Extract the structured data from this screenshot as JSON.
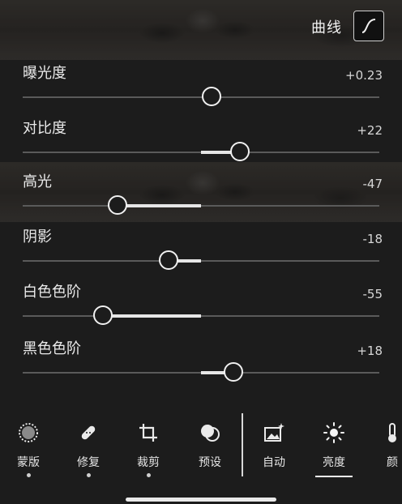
{
  "header": {
    "title": "曲线",
    "curve_icon": "curve-icon"
  },
  "sliders": [
    {
      "label": "曝光度",
      "value_text": "+0.23",
      "value": 0.23,
      "position": 0.53,
      "fill_from": 0.53,
      "fill_to": 0.53
    },
    {
      "label": "对比度",
      "value_text": "+22",
      "value": 22,
      "position": 0.61,
      "fill_from": 0.5,
      "fill_to": 0.61
    },
    {
      "label": "高光",
      "value_text": "-47",
      "value": -47,
      "position": 0.265,
      "fill_from": 0.265,
      "fill_to": 0.5
    },
    {
      "label": "阴影",
      "value_text": "-18",
      "value": -18,
      "position": 0.41,
      "fill_from": 0.41,
      "fill_to": 0.5
    },
    {
      "label": "白色色阶",
      "value_text": "-55",
      "value": -55,
      "position": 0.225,
      "fill_from": 0.225,
      "fill_to": 0.5
    },
    {
      "label": "黑色色阶",
      "value_text": "+18",
      "value": 18,
      "position": 0.59,
      "fill_from": 0.5,
      "fill_to": 0.59
    }
  ],
  "toolbar": {
    "items": [
      {
        "label": "蒙版",
        "icon": "mask-icon",
        "dot": true
      },
      {
        "label": "修复",
        "icon": "bandage-icon",
        "dot": true
      },
      {
        "label": "裁剪",
        "icon": "crop-icon",
        "dot": true
      },
      {
        "label": "预设",
        "icon": "presets-icon",
        "dot": false
      },
      {
        "label": "自动",
        "icon": "auto-icon",
        "dot": false
      },
      {
        "label": "亮度",
        "icon": "sun-icon",
        "dot": false,
        "active": true
      },
      {
        "label": "颜",
        "icon": "thermometer-icon",
        "dot": false
      }
    ]
  },
  "colors": {
    "panel": "#1c1c1c",
    "thumb": "#f0f0f0",
    "track": "#5a5a5a"
  }
}
